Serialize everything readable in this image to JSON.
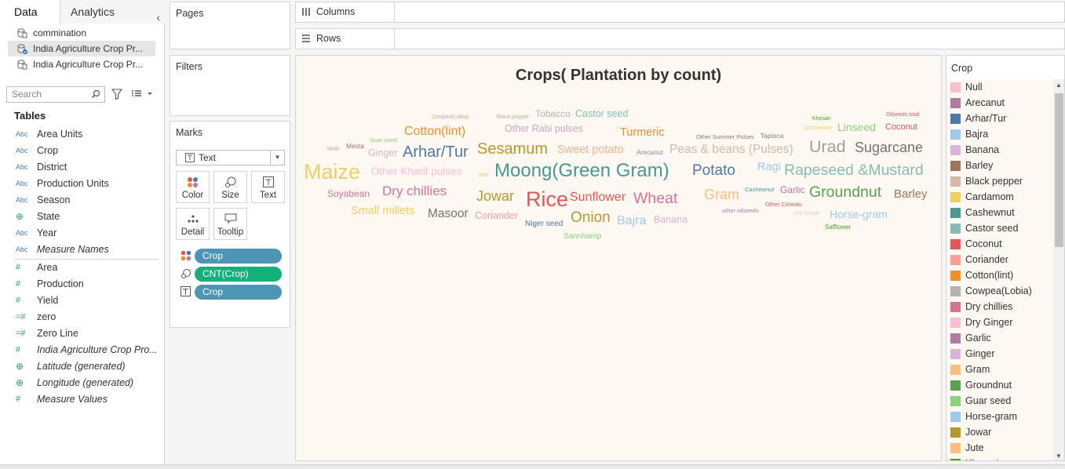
{
  "tabs": {
    "data": "Data",
    "analytics": "Analytics"
  },
  "datasources": [
    "commination",
    "India Agriculture Crop Pr...",
    "India Agriculture Crop Pr..."
  ],
  "search": {
    "placeholder": "Search"
  },
  "tables_heading": "Tables",
  "fields": [
    {
      "type": "Abc",
      "name": "Area Units",
      "italic": false
    },
    {
      "type": "Abc",
      "name": "Crop",
      "italic": false
    },
    {
      "type": "Abc",
      "name": "District",
      "italic": false
    },
    {
      "type": "Abc",
      "name": "Production Units",
      "italic": false
    },
    {
      "type": "Abc",
      "name": "Season",
      "italic": false
    },
    {
      "type": "globe",
      "name": "State",
      "italic": false
    },
    {
      "type": "Abc",
      "name": "Year",
      "italic": false
    },
    {
      "type": "Abc",
      "name": "Measure Names",
      "italic": true
    },
    {
      "type": "#",
      "name": "Area",
      "italic": false
    },
    {
      "type": "#",
      "name": "Production",
      "italic": false
    },
    {
      "type": "#",
      "name": "Yield",
      "italic": false
    },
    {
      "type": "=#",
      "name": "zero",
      "italic": false
    },
    {
      "type": "=#",
      "name": "Zero Line",
      "italic": false
    },
    {
      "type": "#",
      "name": "India Agriculture Crop Pro...",
      "italic": true
    },
    {
      "type": "globe",
      "name": "Latitude (generated)",
      "italic": true
    },
    {
      "type": "globe",
      "name": "Longitude (generated)",
      "italic": true
    },
    {
      "type": "#",
      "name": "Measure Values",
      "italic": true
    }
  ],
  "cards": {
    "pages": "Pages",
    "filters": "Filters",
    "marks": "Marks"
  },
  "marks": {
    "type": "Text",
    "buttons": [
      "Color",
      "Size",
      "Text",
      "Detail",
      "Tooltip"
    ],
    "pills": [
      {
        "label": "Crop",
        "color": "#4e94b4",
        "icon": "color-icon"
      },
      {
        "label": "CNT(Crop)",
        "color": "#13b07a",
        "icon": "size-icon"
      },
      {
        "label": "Crop",
        "color": "#4e94b4",
        "icon": "text-icon"
      }
    ]
  },
  "shelves": {
    "columns": "Columns",
    "rows": "Rows"
  },
  "viz": {
    "title": "Crops( Plantation by count)",
    "words": [
      {
        "t": "Cowpea(Lobia)",
        "c": "#d4a59a",
        "fs": 7
      },
      {
        "t": "Black pepper",
        "c": "#c9a99d",
        "fs": 7
      },
      {
        "t": "Tobacco",
        "c": "#b3b3b3",
        "fs": 12
      },
      {
        "t": "Castor seed",
        "c": "#86bcb6",
        "fs": 12.5
      },
      {
        "t": "Cotton(lint)",
        "c": "#f28e2b",
        "fs": 16
      },
      {
        "t": "Other Rabi pulses",
        "c": "#c9a9c4",
        "fs": 12.5
      },
      {
        "t": "Turmeric",
        "c": "#e8902a",
        "fs": 14.5
      },
      {
        "t": "Other Summer Pulses",
        "c": "#8a7e6c",
        "fs": 7.5
      },
      {
        "t": "Tapioca",
        "c": "#8a7e6c",
        "fs": 8.5
      },
      {
        "t": "Khesari",
        "c": "#4aa02c",
        "fs": 7
      },
      {
        "t": "Cardamom",
        "c": "#f1ce63",
        "fs": 7
      },
      {
        "t": "Linseed",
        "c": "#8cd17d",
        "fs": 14
      },
      {
        "t": "Oilseeds total",
        "c": "#e15759",
        "fs": 7
      },
      {
        "t": "Coconut",
        "c": "#e15759",
        "fs": 11
      },
      {
        "t": "Guar seed",
        "c": "#8cd17d",
        "fs": 7.5
      },
      {
        "t": "Moth",
        "c": "#d4a59a",
        "fs": 7
      },
      {
        "t": "Mesta",
        "c": "#9d7660",
        "fs": 8.5
      },
      {
        "t": "Ginger",
        "c": "#d7b5d8",
        "fs": 12.5
      },
      {
        "t": "Arhar/Tur",
        "c": "#4e79a7",
        "fs": 20
      },
      {
        "t": "Sesamum",
        "c": "#b6992d",
        "fs": 20
      },
      {
        "t": "Sweet potato",
        "c": "#f6b28c",
        "fs": 14.5
      },
      {
        "t": "Arecanut",
        "c": "#b07aa1",
        "fs": 8.5
      },
      {
        "t": "Peas & beans (Pulses)",
        "c": "#d4b9a8",
        "fs": 15.5
      },
      {
        "t": "Urad",
        "c": "#a69e95",
        "fs": 21.5
      },
      {
        "t": "Sugarcane",
        "c": "#79706e",
        "fs": 18
      },
      {
        "t": "Maize",
        "c": "#f1ce63",
        "fs": 27
      },
      {
        "t": "Other Kharif pulses",
        "c": "#fabfd2",
        "fs": 13.5
      },
      {
        "t": "Jute",
        "c": "#ffbe7d",
        "fs": 7
      },
      {
        "t": "Moong(Green Gram)",
        "c": "#499894",
        "fs": 24
      },
      {
        "t": "Potato",
        "c": "#4e79a7",
        "fs": 19
      },
      {
        "t": "Ragi",
        "c": "#a0cbe8",
        "fs": 14.5
      },
      {
        "t": "Rapeseed &Mustard",
        "c": "#86bcb6",
        "fs": 19.5
      },
      {
        "t": "Soyabean",
        "c": "#d37295",
        "fs": 12
      },
      {
        "t": "Dry chillies",
        "c": "#d37295",
        "fs": 17
      },
      {
        "t": "Jowar",
        "c": "#b6992d",
        "fs": 18
      },
      {
        "t": "Rice",
        "c": "#e15759",
        "fs": 27
      },
      {
        "t": "Sunflower",
        "c": "#e15759",
        "fs": 16
      },
      {
        "t": "Wheat",
        "c": "#d37295",
        "fs": 19.5
      },
      {
        "t": "Gram",
        "c": "#ffbe7d",
        "fs": 18
      },
      {
        "t": "Cashewnut",
        "c": "#499894",
        "fs": 7.5
      },
      {
        "t": "Garlic",
        "c": "#b07aa1",
        "fs": 12
      },
      {
        "t": "Groundnut",
        "c": "#59a14f",
        "fs": 19.5
      },
      {
        "t": "Barley",
        "c": "#9d7660",
        "fs": 15
      },
      {
        "t": "Other Cereals",
        "c": "#e15759",
        "fs": 7.5
      },
      {
        "t": "Dry Ginger",
        "c": "#fabfd2",
        "fs": 7
      },
      {
        "t": "other oilseeds",
        "c": "#b07aa1",
        "fs": 7.5
      },
      {
        "t": "Horse-gram",
        "c": "#a0cbe8",
        "fs": 14
      },
      {
        "t": "Small millets",
        "c": "#f1ce63",
        "fs": 14.5
      },
      {
        "t": "Masoor",
        "c": "#79706e",
        "fs": 15.5
      },
      {
        "t": "Coriander",
        "c": "#ff9d9a",
        "fs": 12.5
      },
      {
        "t": "Onion",
        "c": "#b6992d",
        "fs": 19
      },
      {
        "t": "Bajra",
        "c": "#a0cbe8",
        "fs": 16
      },
      {
        "t": "Banana",
        "c": "#d7b5d8",
        "fs": 12.5
      },
      {
        "t": "Niger seed",
        "c": "#4e79a7",
        "fs": 10
      },
      {
        "t": "Safflower",
        "c": "#4aa02c",
        "fs": 8
      },
      {
        "t": "Sannhamp",
        "c": "#8cd17d",
        "fs": 10
      }
    ]
  },
  "legend": {
    "title": "Crop",
    "items": [
      {
        "label": "Null",
        "color": "#fabfd2"
      },
      {
        "label": "Arecanut",
        "color": "#b07aa1"
      },
      {
        "label": "Arhar/Tur",
        "color": "#4e79a7"
      },
      {
        "label": "Bajra",
        "color": "#a0cbe8"
      },
      {
        "label": "Banana",
        "color": "#d7b5d8"
      },
      {
        "label": "Barley",
        "color": "#9d7660"
      },
      {
        "label": "Black pepper",
        "color": "#d4b9a8"
      },
      {
        "label": "Cardamom",
        "color": "#f1ce63"
      },
      {
        "label": "Cashewnut",
        "color": "#499894"
      },
      {
        "label": "Castor seed",
        "color": "#86bcb6"
      },
      {
        "label": "Coconut",
        "color": "#e15759"
      },
      {
        "label": "Coriander",
        "color": "#ff9d9a"
      },
      {
        "label": "Cotton(lint)",
        "color": "#f28e2b"
      },
      {
        "label": "Cowpea(Lobia)",
        "color": "#bab0ac"
      },
      {
        "label": "Dry chillies",
        "color": "#d37295"
      },
      {
        "label": "Dry Ginger",
        "color": "#fabfd2"
      },
      {
        "label": "Garlic",
        "color": "#b07aa1"
      },
      {
        "label": "Ginger",
        "color": "#d7b5d8"
      },
      {
        "label": "Gram",
        "color": "#ffbe7d"
      },
      {
        "label": "Groundnut",
        "color": "#59a14f"
      },
      {
        "label": "Guar seed",
        "color": "#8cd17d"
      },
      {
        "label": "Horse-gram",
        "color": "#a0cbe8"
      },
      {
        "label": "Jowar",
        "color": "#b6992d"
      },
      {
        "label": "Jute",
        "color": "#ffbe7d"
      },
      {
        "label": "Khesari",
        "color": "#4aa02c"
      }
    ]
  }
}
